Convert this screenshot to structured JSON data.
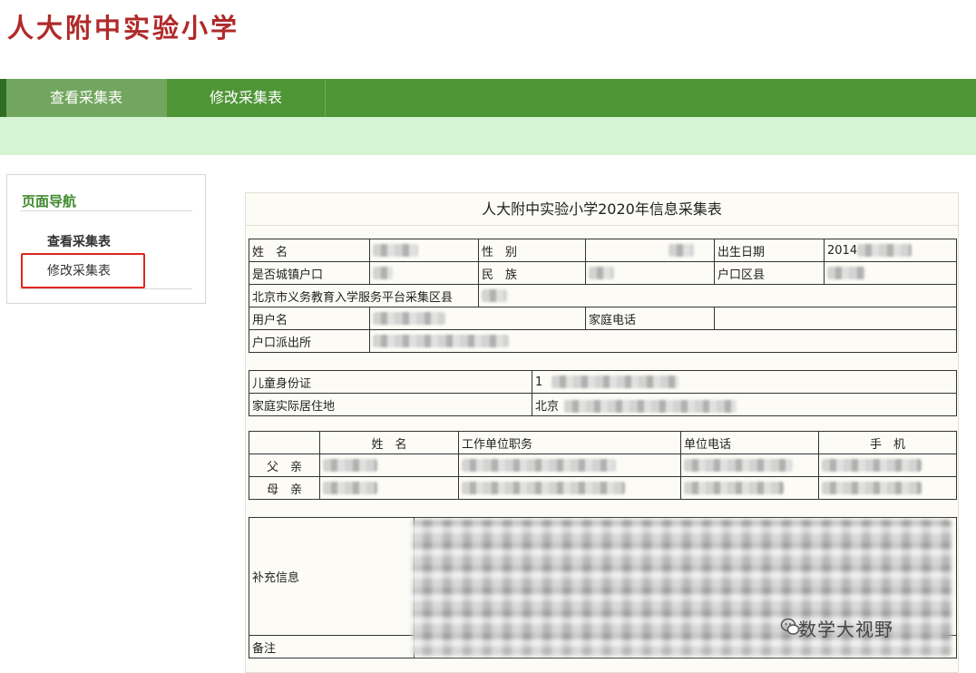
{
  "header": {
    "school_name": "人大附中实验小学"
  },
  "nav": {
    "tabs": [
      {
        "label": "查看采集表",
        "active": true
      },
      {
        "label": "修改采集表",
        "active": false
      }
    ]
  },
  "sidebar": {
    "title": "页面导航",
    "items": [
      {
        "label": "查看采集表"
      },
      {
        "label": "修改采集表"
      }
    ]
  },
  "form": {
    "title": "人大附中实验小学2020年信息采集表",
    "basic": {
      "name_label": "姓　名",
      "gender_label": "性　别",
      "birth_label": "出生日期",
      "birth_value_prefix": "2014",
      "urban_label": "是否城镇户口",
      "ethnic_label": "民　族",
      "district_label": "户口区县",
      "platform_label": "北京市义务教育入学服务平台采集区县",
      "username_label": "用户名",
      "phone_label": "家庭电话",
      "police_label": "户口派出所"
    },
    "id_section": {
      "child_id_label": "儿童身份证",
      "child_id_prefix": "1",
      "address_label": "家庭实际居住地",
      "address_prefix": "北京"
    },
    "parents": {
      "headers": [
        "姓　名",
        "工作单位职务",
        "单位电话",
        "手　机"
      ],
      "rows": [
        {
          "label": "父　亲"
        },
        {
          "label": "母　亲"
        }
      ]
    },
    "extra": {
      "supplement_label": "补充信息",
      "remark_label": "备注"
    }
  },
  "watermark": {
    "text": "数学大视野",
    "icon": "wechat-icon"
  },
  "colors": {
    "nav_green": "#4e9536",
    "subbar": "#d4f4d4",
    "logo_red": "#b02a2a",
    "highlight": "#e0261f"
  }
}
